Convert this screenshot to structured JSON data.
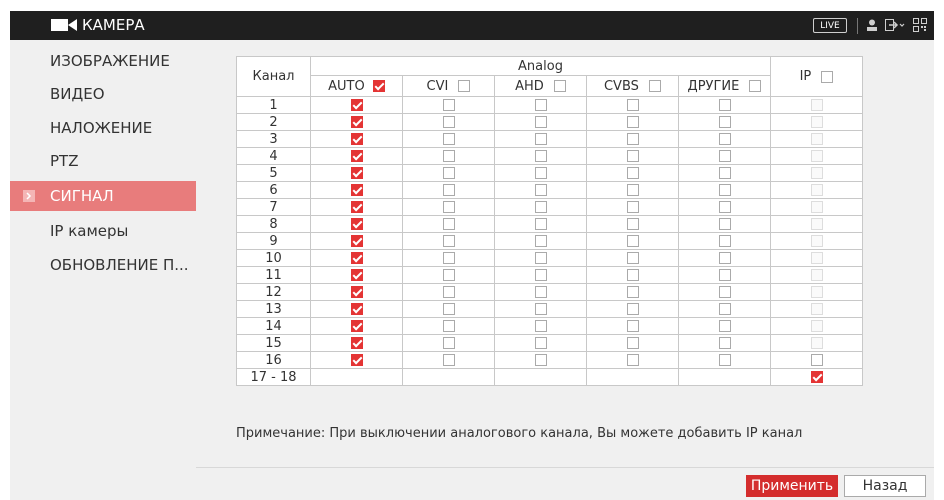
{
  "window": {
    "title": "КАМЕРА",
    "live_badge": "LIVE"
  },
  "sidebar": {
    "items": [
      {
        "label": "ИЗОБРАЖЕНИЕ",
        "active": false
      },
      {
        "label": "ВИДЕО",
        "active": false
      },
      {
        "label": "НАЛОЖЕНИЕ",
        "active": false
      },
      {
        "label": "PTZ",
        "active": false
      },
      {
        "label": "СИГНАЛ",
        "active": true
      },
      {
        "label": "IP камеры",
        "active": false
      },
      {
        "label": "ОБНОВЛЕНИЕ П...",
        "active": false
      }
    ]
  },
  "table": {
    "header": {
      "channel": "Канал",
      "group": "Analog",
      "auto": "AUTO",
      "cvi": "CVI",
      "ahd": "AHD",
      "cvbs": "CVBS",
      "other": "ДРУГИЕ",
      "ip": "IP"
    },
    "header_checks": {
      "auto": true,
      "cvi": false,
      "ahd": false,
      "cvbs": false,
      "other": false,
      "ip": false
    },
    "rows": [
      {
        "channel": "1",
        "auto": true,
        "cvi": false,
        "ahd": false,
        "cvbs": false,
        "other": false,
        "ip": false,
        "ip_enabled": false
      },
      {
        "channel": "2",
        "auto": true,
        "cvi": false,
        "ahd": false,
        "cvbs": false,
        "other": false,
        "ip": false,
        "ip_enabled": false
      },
      {
        "channel": "3",
        "auto": true,
        "cvi": false,
        "ahd": false,
        "cvbs": false,
        "other": false,
        "ip": false,
        "ip_enabled": false
      },
      {
        "channel": "4",
        "auto": true,
        "cvi": false,
        "ahd": false,
        "cvbs": false,
        "other": false,
        "ip": false,
        "ip_enabled": false
      },
      {
        "channel": "5",
        "auto": true,
        "cvi": false,
        "ahd": false,
        "cvbs": false,
        "other": false,
        "ip": false,
        "ip_enabled": false
      },
      {
        "channel": "6",
        "auto": true,
        "cvi": false,
        "ahd": false,
        "cvbs": false,
        "other": false,
        "ip": false,
        "ip_enabled": false
      },
      {
        "channel": "7",
        "auto": true,
        "cvi": false,
        "ahd": false,
        "cvbs": false,
        "other": false,
        "ip": false,
        "ip_enabled": false
      },
      {
        "channel": "8",
        "auto": true,
        "cvi": false,
        "ahd": false,
        "cvbs": false,
        "other": false,
        "ip": false,
        "ip_enabled": false
      },
      {
        "channel": "9",
        "auto": true,
        "cvi": false,
        "ahd": false,
        "cvbs": false,
        "other": false,
        "ip": false,
        "ip_enabled": false
      },
      {
        "channel": "10",
        "auto": true,
        "cvi": false,
        "ahd": false,
        "cvbs": false,
        "other": false,
        "ip": false,
        "ip_enabled": false
      },
      {
        "channel": "11",
        "auto": true,
        "cvi": false,
        "ahd": false,
        "cvbs": false,
        "other": false,
        "ip": false,
        "ip_enabled": false
      },
      {
        "channel": "12",
        "auto": true,
        "cvi": false,
        "ahd": false,
        "cvbs": false,
        "other": false,
        "ip": false,
        "ip_enabled": false
      },
      {
        "channel": "13",
        "auto": true,
        "cvi": false,
        "ahd": false,
        "cvbs": false,
        "other": false,
        "ip": false,
        "ip_enabled": false
      },
      {
        "channel": "14",
        "auto": true,
        "cvi": false,
        "ahd": false,
        "cvbs": false,
        "other": false,
        "ip": false,
        "ip_enabled": false
      },
      {
        "channel": "15",
        "auto": true,
        "cvi": false,
        "ahd": false,
        "cvbs": false,
        "other": false,
        "ip": false,
        "ip_enabled": false
      },
      {
        "channel": "16",
        "auto": true,
        "cvi": false,
        "ahd": false,
        "cvbs": false,
        "other": false,
        "ip": false,
        "ip_enabled": true
      }
    ],
    "extra_row": {
      "channel": "17 - 18",
      "ip": true
    }
  },
  "note": "Примечание: При выключении аналогового канала, Вы можете добавить IP канал",
  "buttons": {
    "apply": "Применить",
    "back": "Назад"
  },
  "colors": {
    "accent": "#d42d2d",
    "sidebar_active": "#e87c7c",
    "titlebar": "#1f1f1f"
  },
  "icons": {
    "title": "camera-icon",
    "user": "user-icon",
    "exit": "logout-icon",
    "qr": "qr-code-icon",
    "sidebar_active": "arrow-right-icon"
  }
}
